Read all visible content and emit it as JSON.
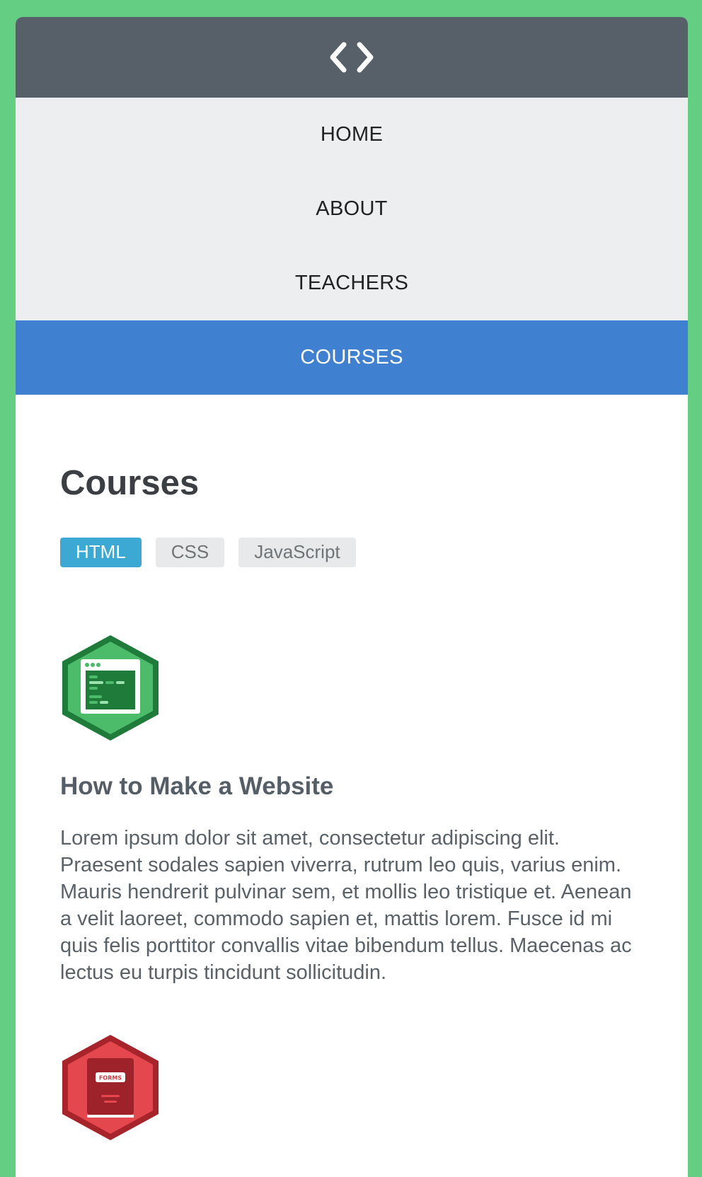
{
  "header": {
    "logo_icon": "code-brackets-icon"
  },
  "nav": {
    "items": [
      {
        "label": "HOME"
      },
      {
        "label": "ABOUT"
      },
      {
        "label": "TEACHERS"
      },
      {
        "label": "COURSES",
        "active": true
      }
    ]
  },
  "main": {
    "title": "Courses",
    "tags": [
      {
        "label": "HTML",
        "active": true
      },
      {
        "label": "CSS"
      },
      {
        "label": "JavaScript"
      }
    ],
    "courses": [
      {
        "icon": "html-badge-icon",
        "title": "How to Make a Website",
        "description": "Lorem ipsum dolor sit amet, consectetur adipiscing elit. Praesent sodales sapien viverra, rutrum leo quis, varius enim. Mauris hendrerit pulvinar sem, et mollis leo tristique et. Aenean a velit laoreet, commodo sapien et, mattis lorem. Fusce id mi quis felis porttitor convallis vitae bibendum tellus. Maecenas ac lectus eu turpis tincidunt sollicitudin."
      },
      {
        "icon": "forms-badge-icon",
        "badge_text": "FORMS"
      }
    ]
  },
  "colors": {
    "background": "#64cf83",
    "header": "#575f69",
    "nav_bg": "#edeef0",
    "nav_active": "#3f81d0",
    "tag_active": "#3ca9d4",
    "html_badge": "#2e9a4f",
    "forms_badge": "#d9363d"
  }
}
